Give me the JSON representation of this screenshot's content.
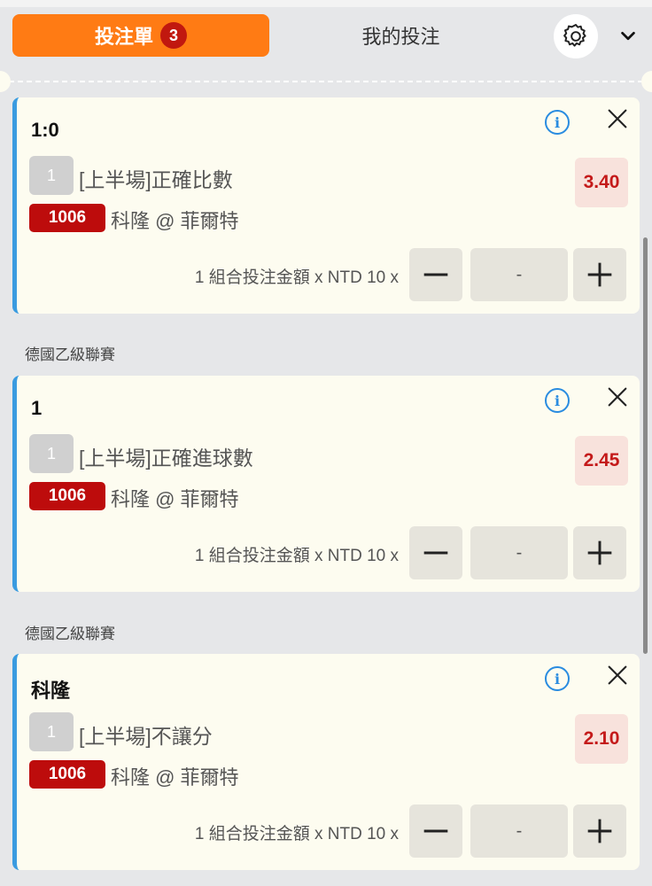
{
  "header": {
    "betslip_label": "投注單",
    "betslip_count": "3",
    "mybets_label": "我的投注",
    "settings_icon": "gear-icon",
    "collapse_icon": "chevron-down-icon"
  },
  "colors": {
    "accent_orange": "#ff7b14",
    "badge_red": "#c1180f",
    "event_red": "#bd0c0c",
    "odds_red": "#c41a1a",
    "info_blue": "#2a8ce0",
    "card_bg": "#fdfcf0",
    "card_border": "#3a9be0"
  },
  "bets": [
    {
      "selection": "1:0",
      "index": "1",
      "market": "[上半場]正確比數",
      "odds": "3.40",
      "event_id": "1006",
      "match": "科隆 @ 菲爾特",
      "stake_label": "1 組合投注金額 x NTD 10 x",
      "amount": "-"
    },
    {
      "league": "德國乙級聯賽",
      "selection": "1",
      "index": "1",
      "market": "[上半場]正確進球數",
      "odds": "2.45",
      "event_id": "1006",
      "match": "科隆 @ 菲爾特",
      "stake_label": "1 組合投注金額 x NTD 10 x",
      "amount": "-"
    },
    {
      "league": "德國乙級聯賽",
      "selection": "科隆",
      "index": "1",
      "market": "[上半場]不讓分",
      "odds": "2.10",
      "event_id": "1006",
      "match": "科隆 @ 菲爾特",
      "stake_label": "1 組合投注金額 x NTD 10 x",
      "amount": "-"
    }
  ]
}
